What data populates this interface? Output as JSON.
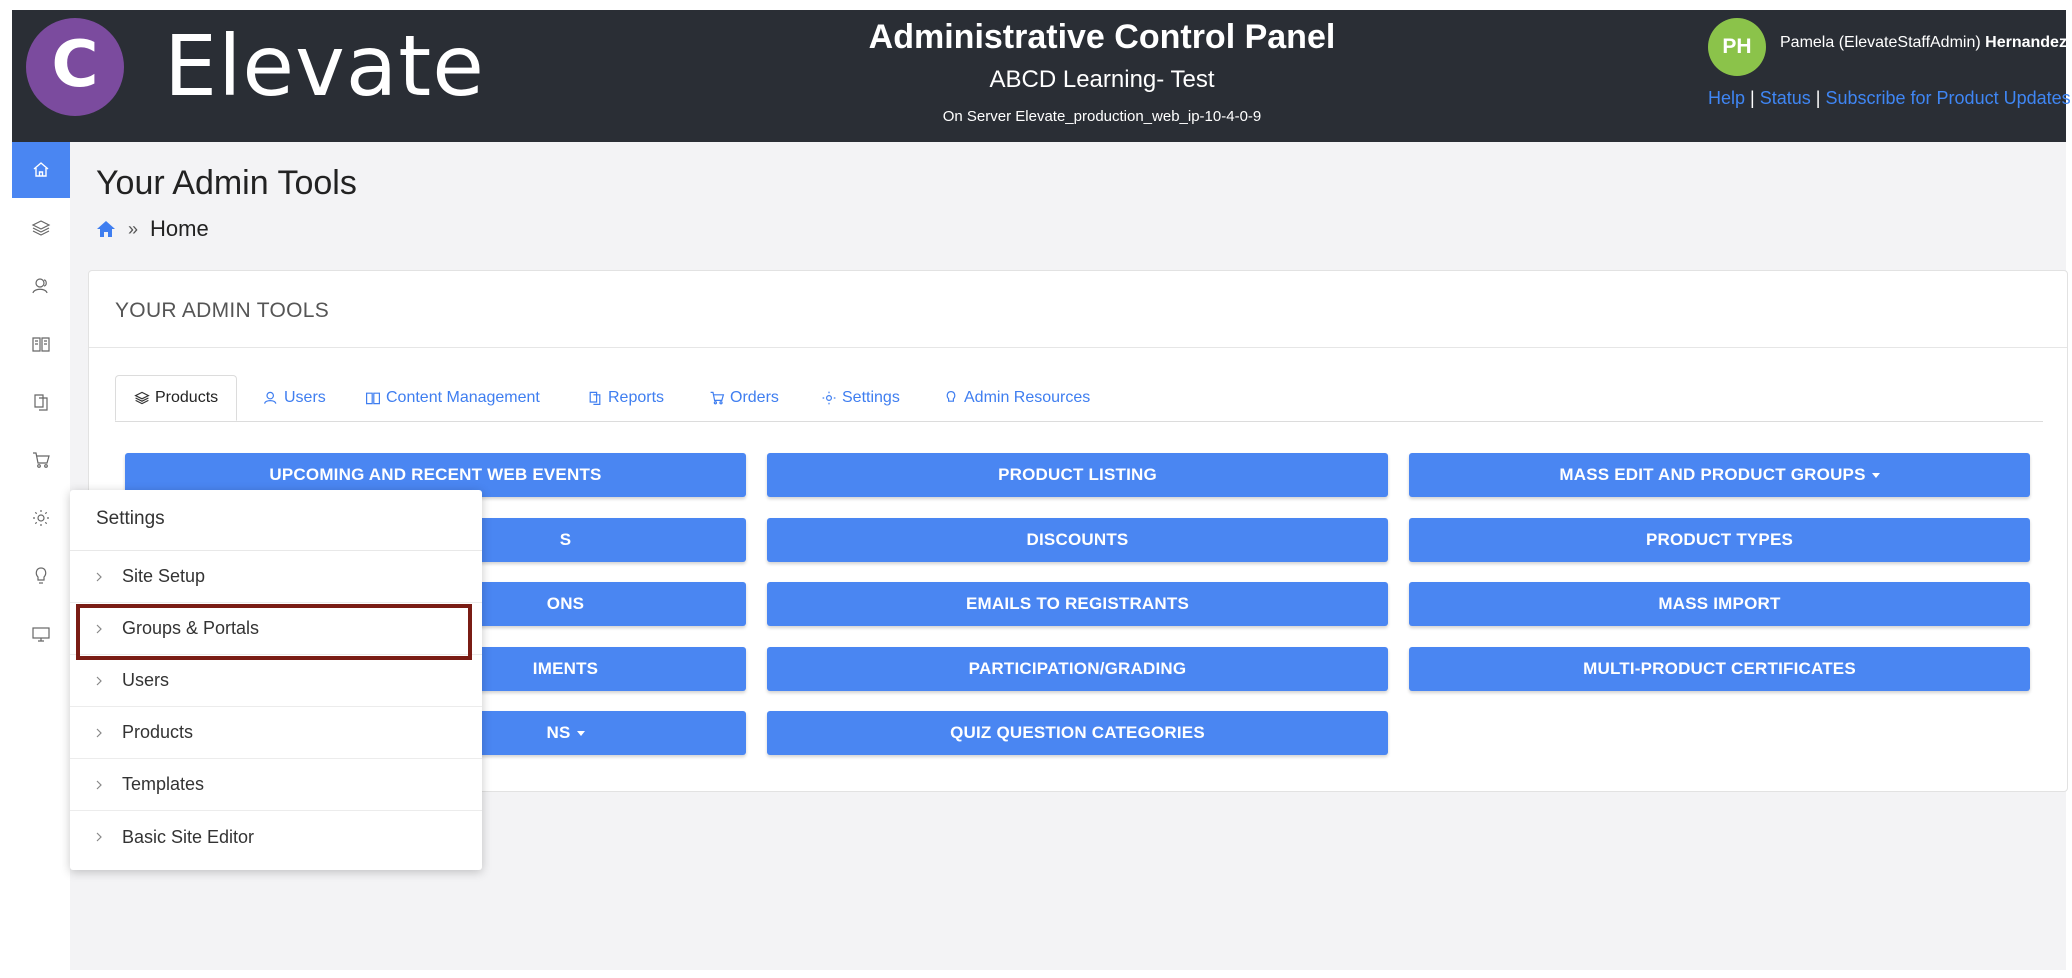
{
  "header": {
    "logo_letter": "C",
    "brand": "Elevate",
    "panel_title": "Administrative Control Panel",
    "site_name": "ABCD Learning- Test",
    "server": "On Server Elevate_production_web_ip-10-4-0-9",
    "avatar_initials": "PH",
    "user_first": "Pamela (ElevateStaffAdmin) ",
    "user_last": "Hernandez",
    "links": [
      "Help",
      "Status",
      "Subscribe for Product Updates"
    ],
    "link_separator": "|"
  },
  "sidebar": {
    "items": [
      "home-icon",
      "layers-icon",
      "users-icon",
      "book-icon",
      "reports-icon",
      "cart-icon",
      "gear-icon",
      "lightbulb-icon",
      "monitor-icon"
    ],
    "active": 0
  },
  "page": {
    "title": "Your Admin Tools",
    "breadcrumb_current": "Home",
    "breadcrumb_separator": "»"
  },
  "card": {
    "title": "YOUR ADMIN TOOLS",
    "tabs": [
      "Products",
      "Users",
      "Content Management",
      "Reports",
      "Orders",
      "Settings",
      "Admin Resources"
    ],
    "active_tab": 0,
    "buttons": {
      "col1": [
        "UPCOMING AND RECENT WEB EVENTS",
        "S",
        "ONS",
        "IMENTS",
        "NS"
      ],
      "col2": [
        "PRODUCT LISTING",
        "DISCOUNTS",
        "EMAILS TO REGISTRANTS",
        "PARTICIPATION/GRADING",
        "QUIZ QUESTION CATEGORIES"
      ],
      "col3": [
        "MASS EDIT AND PRODUCT GROUPS",
        "PRODUCT TYPES",
        "MASS IMPORT",
        "MULTI-PRODUCT CERTIFICATES"
      ]
    }
  },
  "flyout": {
    "title": "Settings",
    "items": [
      "Site Setup",
      "Groups & Portals",
      "Users",
      "Products",
      "Templates",
      "Basic Site Editor"
    ],
    "highlighted": 1
  },
  "colors": {
    "header_bg": "#2a2e35",
    "accent": "#4a86f2",
    "logo": "#7b4b9e",
    "avatar": "#8bc34a",
    "highlight_border": "#7a1c14"
  }
}
